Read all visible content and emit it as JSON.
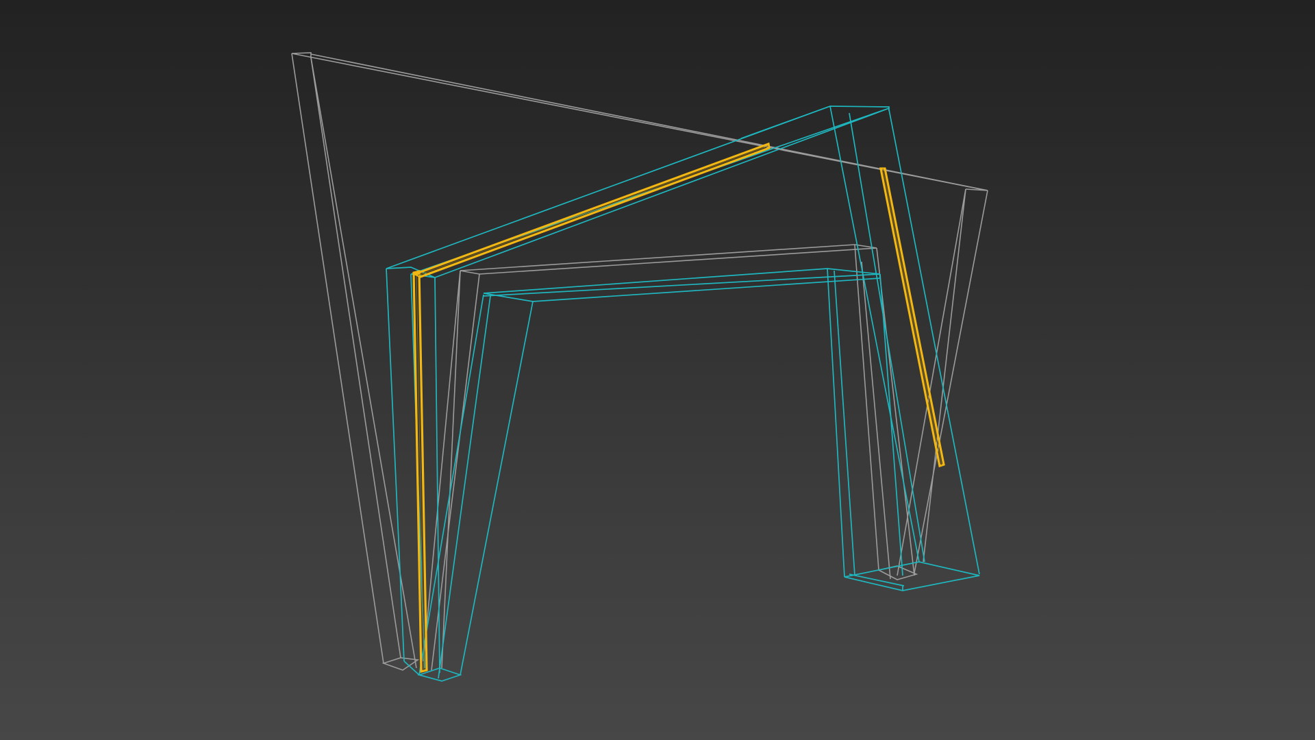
{
  "viewport": {
    "background_top": "#222222",
    "background_bottom": "#474747"
  },
  "objects": [
    {
      "name": "grey-frame",
      "color": "#9c9c9c",
      "selected": false
    },
    {
      "name": "cyan-frame",
      "color": "#1fb7bf",
      "selected": false
    },
    {
      "name": "yellow-members",
      "color": "#f2b712",
      "selected": true
    }
  ]
}
